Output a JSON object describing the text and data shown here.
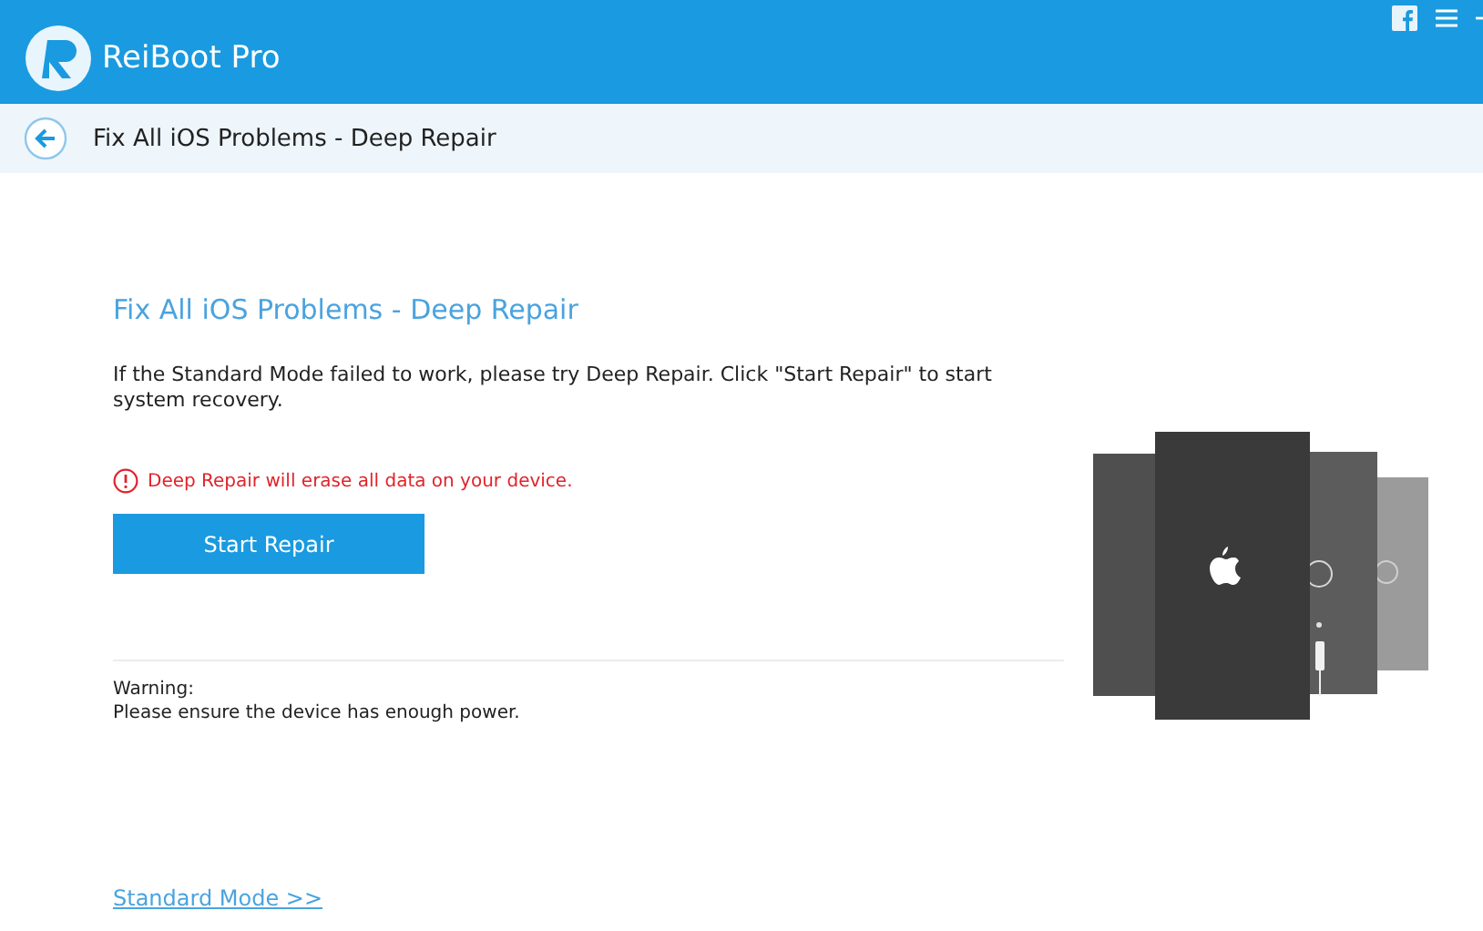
{
  "app": {
    "title": "ReiBoot Pro"
  },
  "nav": {
    "title": "Fix All iOS Problems - Deep Repair"
  },
  "content": {
    "heading": "Fix All iOS Problems - Deep Repair",
    "description": "If the Standard Mode failed to work, please try Deep Repair. Click \"Start Repair\" to start system recovery.",
    "alert": "Deep Repair will erase all data on your device.",
    "button": "Start Repair",
    "warning_title": "Warning:",
    "warning_text": "Please ensure the device has enough power.",
    "link": "Standard Mode >>"
  }
}
